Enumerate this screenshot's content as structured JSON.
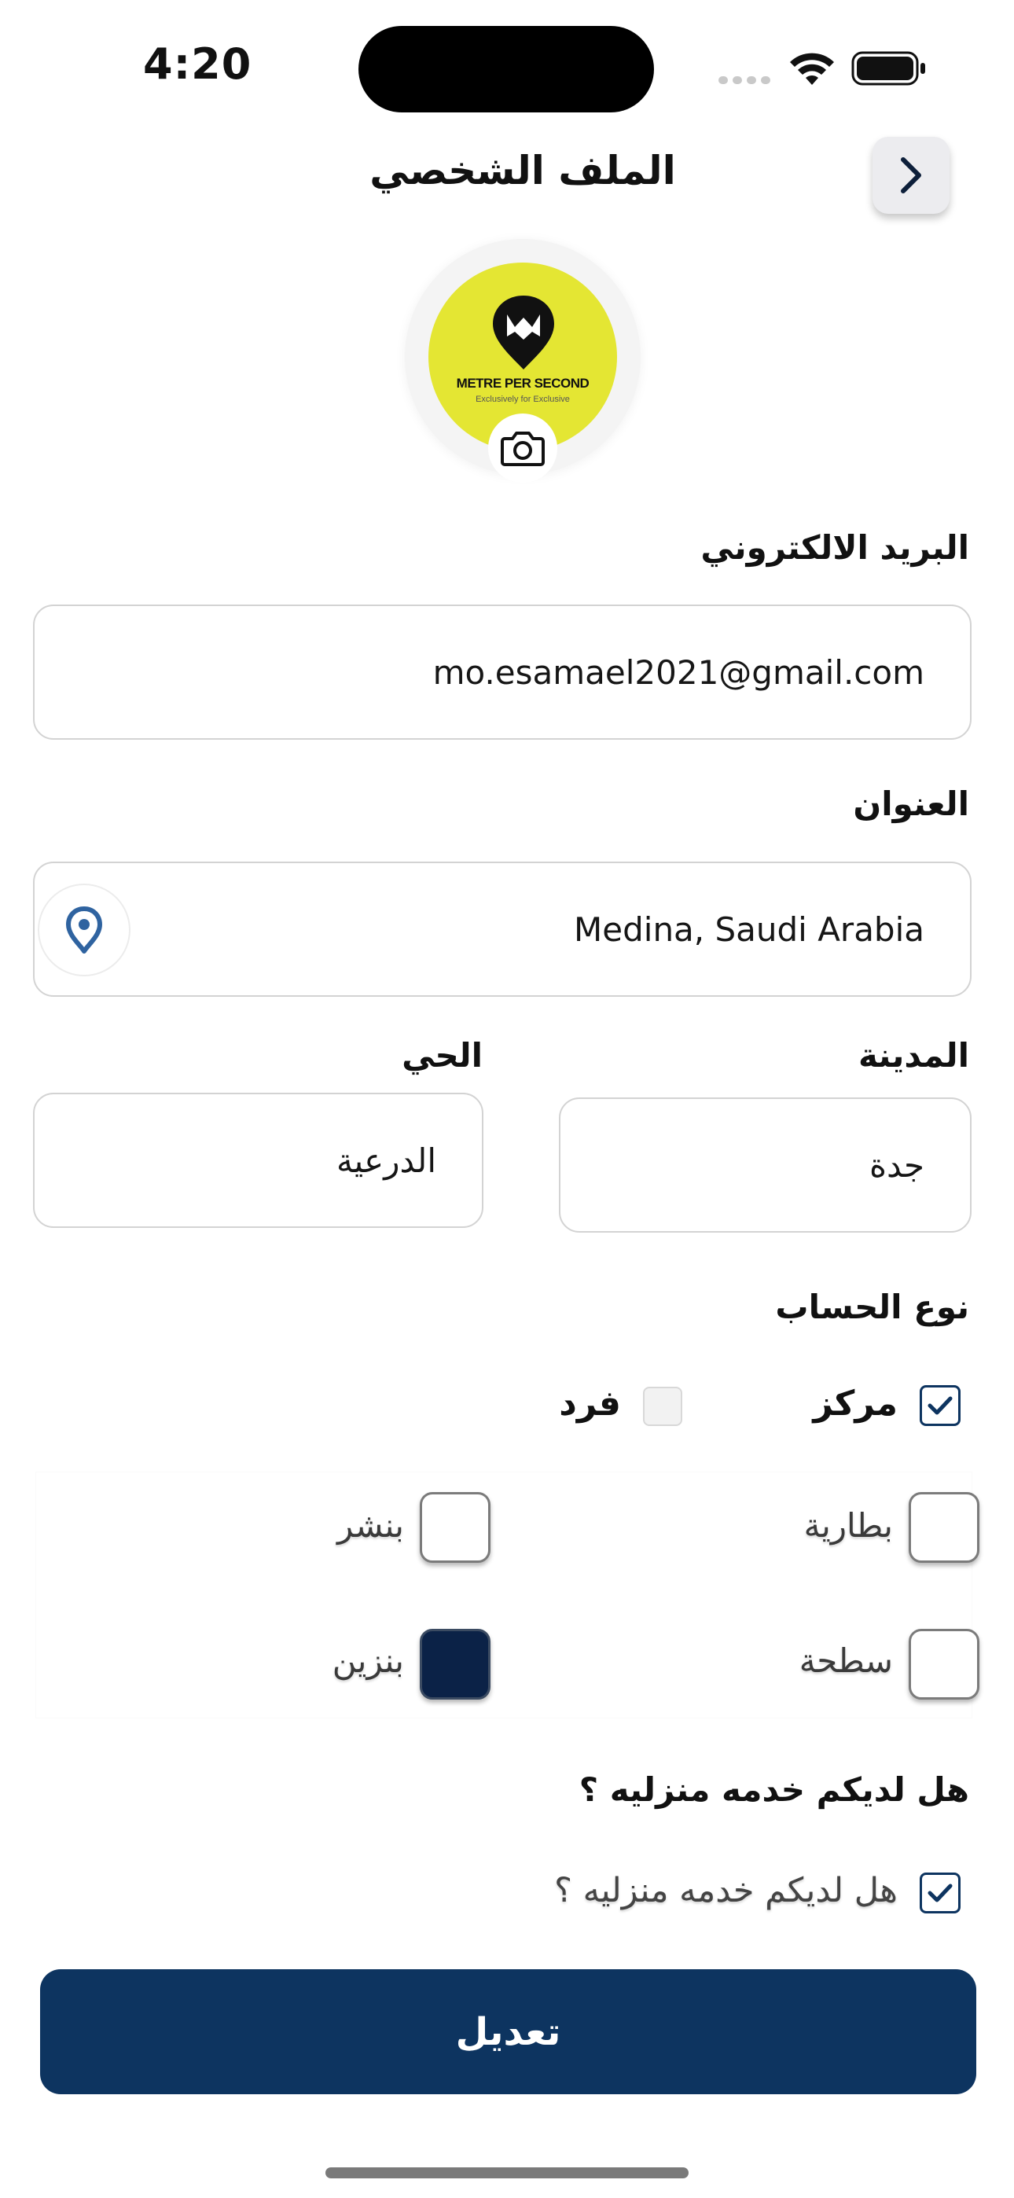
{
  "status_bar": {
    "time": "4:20"
  },
  "header": {
    "title": "الملف الشخصي"
  },
  "avatar": {
    "logo_title": "METRE PER SECOND",
    "logo_subtitle": "Exclusively for Exclusive"
  },
  "form": {
    "email": {
      "label": "البريد الالكتروني",
      "value": "mo.esamael2021@gmail.com"
    },
    "address": {
      "label": "العنوان",
      "value": "Medina, Saudi Arabia"
    },
    "city": {
      "label": "المدينة",
      "value": "جدة"
    },
    "district": {
      "label": "الحي",
      "value": "الدرعية"
    },
    "account_type": {
      "label": "نوع الحساب",
      "options": [
        {
          "label": "مركز",
          "checked": true
        },
        {
          "label": "فرد",
          "checked": false
        }
      ]
    },
    "services": [
      {
        "label": "بطارية",
        "checked": false
      },
      {
        "label": "بنشر",
        "checked": false
      },
      {
        "label": "سطحة",
        "checked": false
      },
      {
        "label": "بنزين",
        "checked": true
      }
    ],
    "home_service": {
      "question": "هل لديكم خدمه منزليه ؟",
      "checkbox_label": "هل لديكم خدمه منزليه ؟",
      "checked": true
    }
  },
  "submit_label": "تعديل",
  "colors": {
    "primary": "#0d3460",
    "logo_yellow": "#e4e633"
  }
}
